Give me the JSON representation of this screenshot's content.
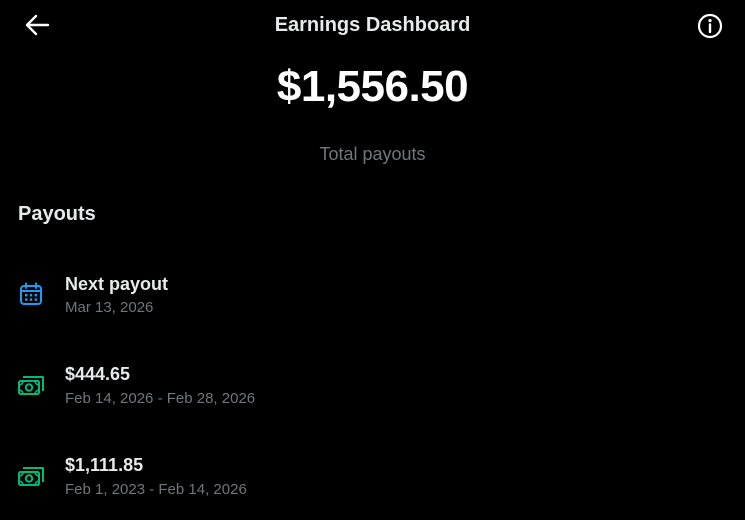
{
  "header": {
    "title": "Earnings Dashboard",
    "back_icon": "arrow-left-icon",
    "info_icon": "info-circle-icon"
  },
  "summary": {
    "total_amount": "$1,556.50",
    "total_label": "Total payouts"
  },
  "payouts": {
    "heading": "Payouts",
    "items": [
      {
        "icon": "calendar-icon",
        "icon_color": "#1d9bf0",
        "primary": "Next payout",
        "secondary": "Mar 13, 2026"
      },
      {
        "icon": "money-icon",
        "icon_color": "#00ba7c",
        "primary": "$444.65",
        "secondary": "Feb 14, 2026 - Feb 28, 2026"
      },
      {
        "icon": "money-icon",
        "icon_color": "#00ba7c",
        "primary": "$1,111.85",
        "secondary": "Feb 1, 2023 - Feb 14, 2026"
      }
    ]
  },
  "colors": {
    "background": "#000000",
    "text_primary": "#e7e9ea",
    "text_secondary": "#71767b",
    "accent_blue": "#1d9bf0",
    "accent_green": "#00ba7c"
  }
}
